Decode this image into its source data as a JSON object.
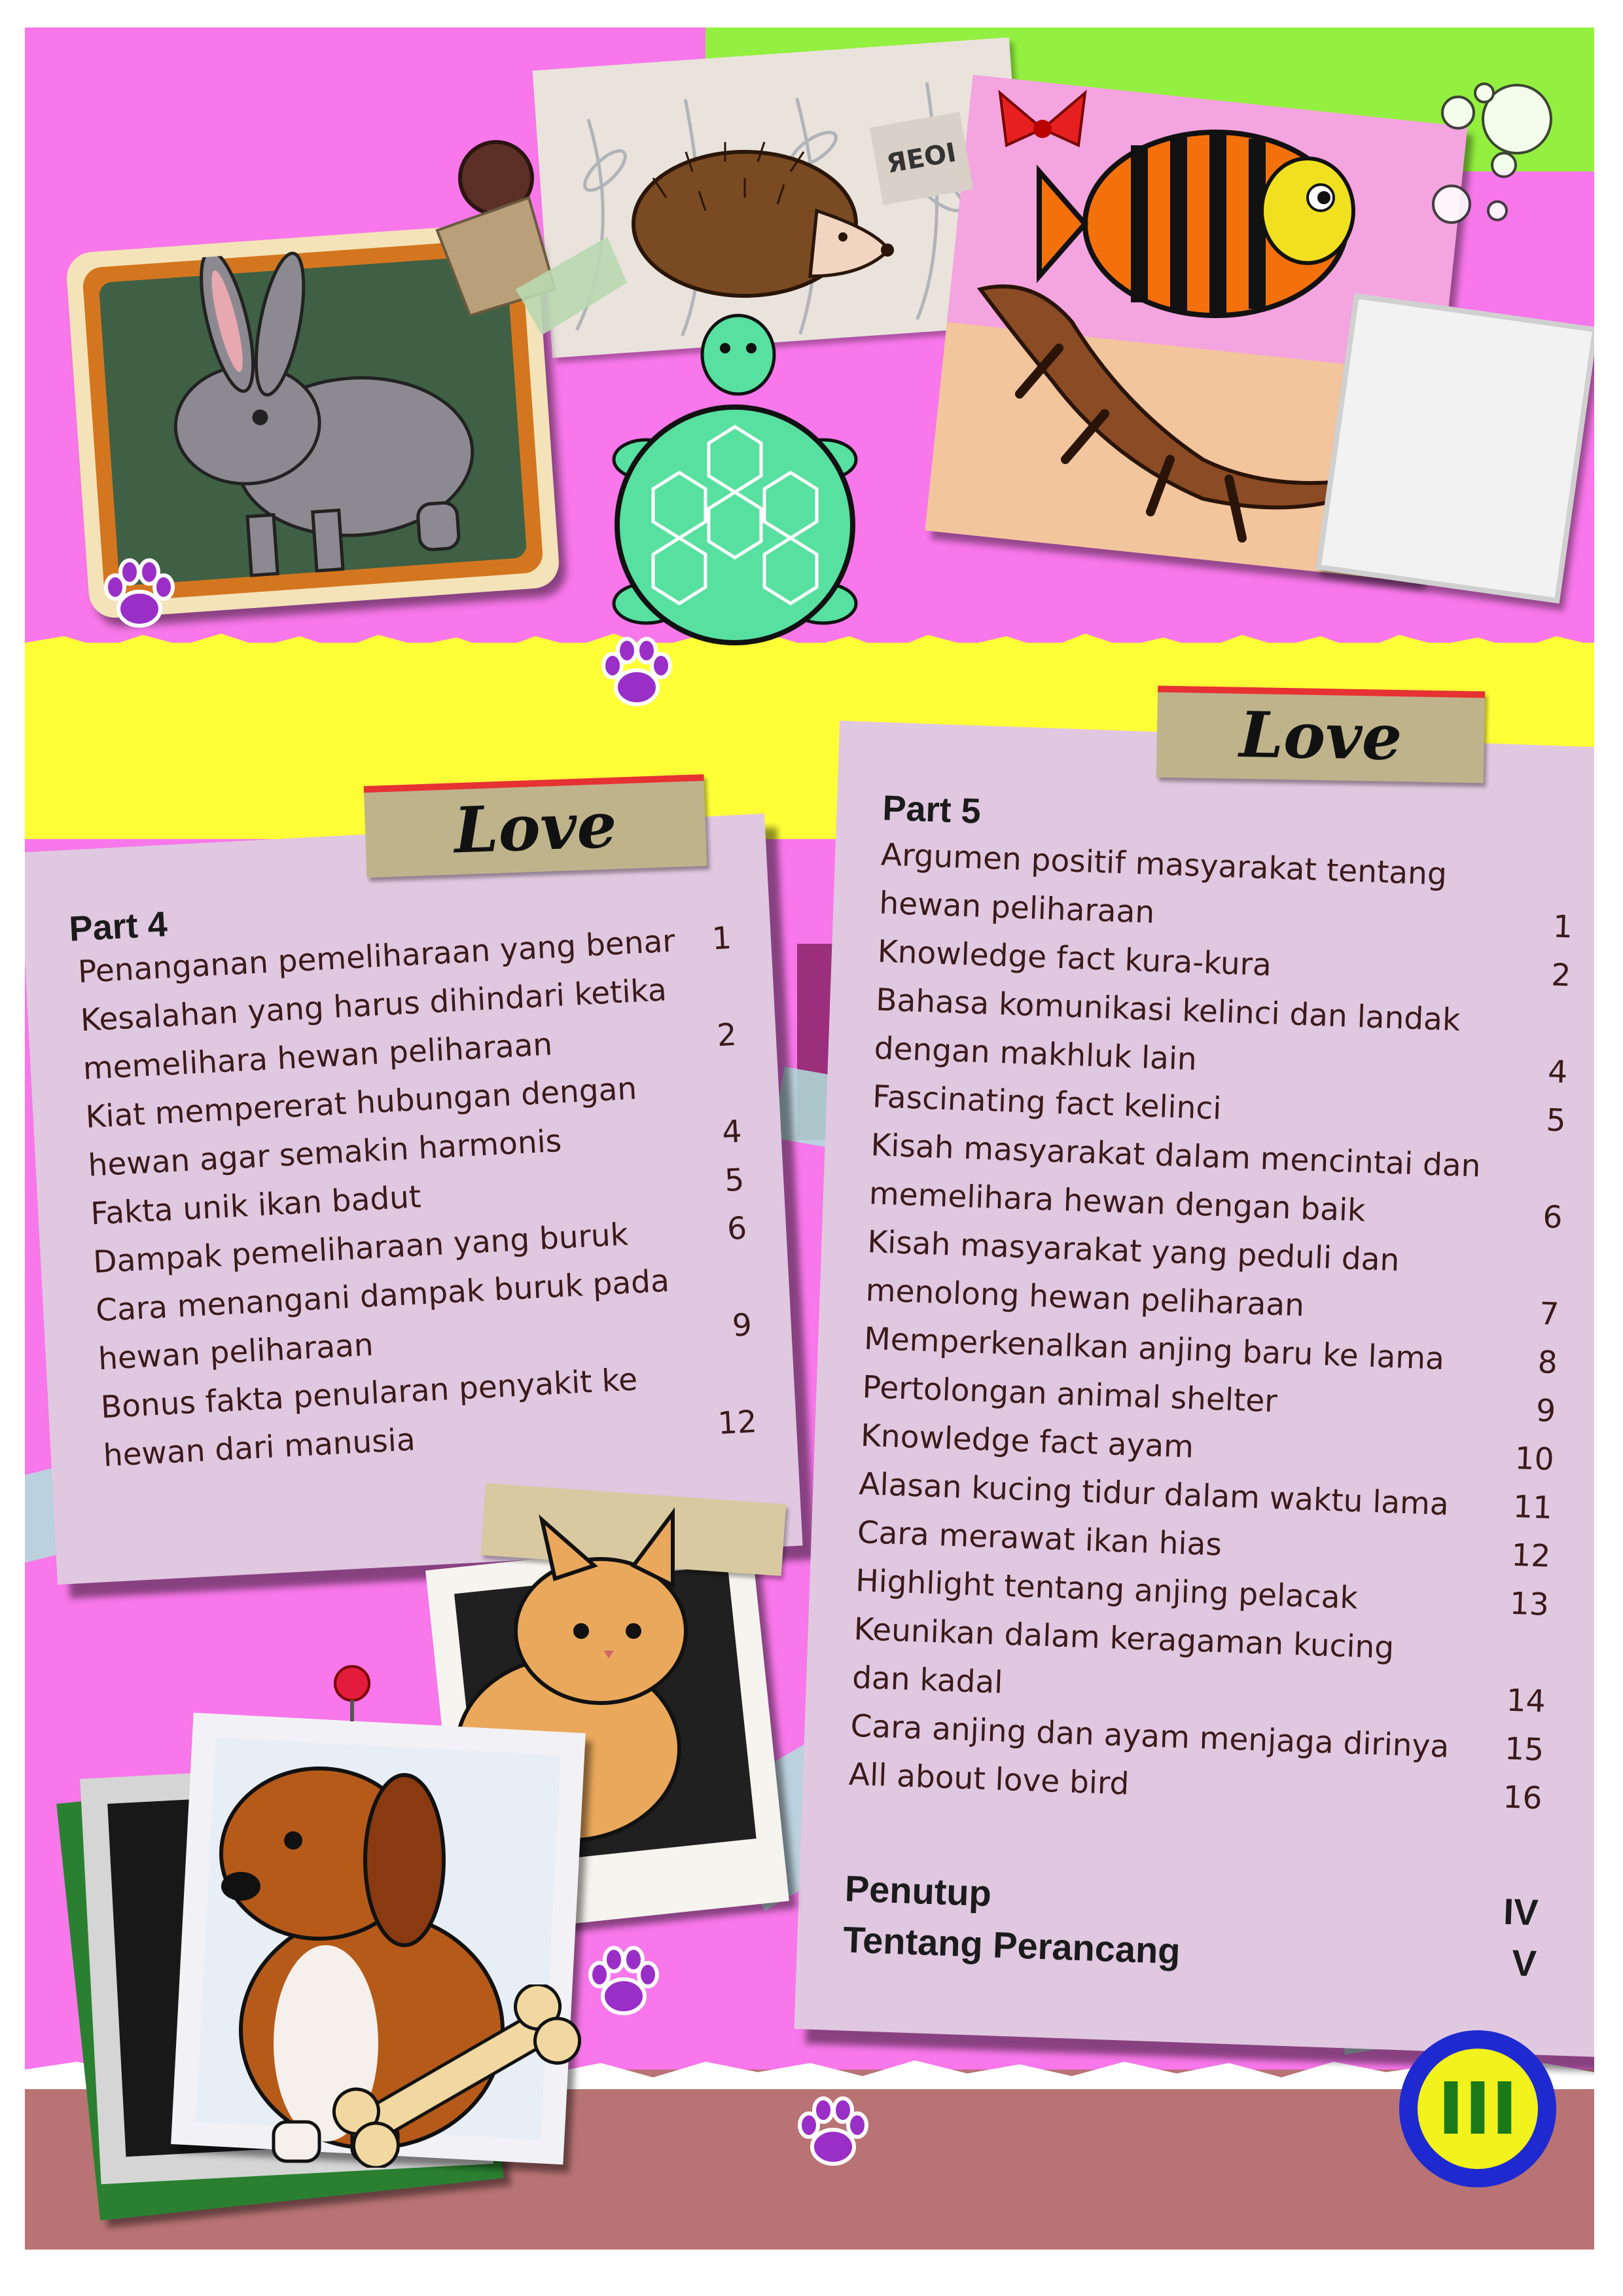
{
  "colors": {
    "page_bg": "#f877ea",
    "yellow_band": "#ffff38",
    "green_band": "#94f040",
    "bottom_band": "#b97374",
    "card": "#e0c8e0",
    "tape": "#b0e0da",
    "paw": "#9a2fc8",
    "page_number_ring": "#1e2ad0",
    "page_number_fill": "#f2f21c"
  },
  "decorations": {
    "tag_text": "Love",
    "fish_label": "ЯEOI"
  },
  "part4": {
    "heading": "Part 4",
    "entries": [
      {
        "lines": [
          "Penanganan pemeliharaan yang benar"
        ],
        "page": "1"
      },
      {
        "lines": [
          "Kesalahan yang harus dihindari ketika",
          "memelihara hewan peliharaan"
        ],
        "page": "2"
      },
      {
        "lines": [
          "Kiat mempererat hubungan dengan",
          "hewan agar semakin harmonis"
        ],
        "page": "4"
      },
      {
        "lines": [
          "Fakta unik ikan badut"
        ],
        "page": "5"
      },
      {
        "lines": [
          "Dampak pemeliharaan yang buruk"
        ],
        "page": "6"
      },
      {
        "lines": [
          "Cara menangani dampak buruk pada",
          "hewan peliharaan"
        ],
        "page": "9"
      },
      {
        "lines": [
          "Bonus fakta penularan penyakit ke",
          "hewan dari manusia"
        ],
        "page": "12"
      }
    ]
  },
  "part5": {
    "heading": "Part 5",
    "entries": [
      {
        "lines": [
          "Argumen positif masyarakat tentang",
          "hewan peliharaan"
        ],
        "page": "1"
      },
      {
        "lines": [
          "Knowledge fact kura-kura"
        ],
        "page": "2"
      },
      {
        "lines": [
          "Bahasa komunikasi kelinci dan landak",
          "dengan makhluk lain"
        ],
        "page": "4"
      },
      {
        "lines": [
          "Fascinating fact kelinci"
        ],
        "page": "5"
      },
      {
        "lines": [
          "Kisah masyarakat dalam mencintai dan",
          "memelihara hewan dengan baik"
        ],
        "page": "6"
      },
      {
        "lines": [
          "Kisah masyarakat yang peduli dan",
          "menolong hewan peliharaan"
        ],
        "page": "7"
      },
      {
        "lines": [
          "Memperkenalkan anjing baru ke lama"
        ],
        "page": "8"
      },
      {
        "lines": [
          "Pertolongan animal shelter"
        ],
        "page": "9"
      },
      {
        "lines": [
          "Knowledge fact ayam"
        ],
        "page": "10"
      },
      {
        "lines": [
          "Alasan kucing tidur dalam waktu lama"
        ],
        "page": "11"
      },
      {
        "lines": [
          "Cara merawat ikan hias"
        ],
        "page": "12"
      },
      {
        "lines": [
          "Highlight tentang anjing pelacak"
        ],
        "page": "13"
      },
      {
        "lines": [
          "Keunikan dalam keragaman kucing",
          "dan kadal"
        ],
        "page": "14"
      },
      {
        "lines": [
          "Cara anjing dan ayam menjaga dirinya"
        ],
        "page": "15"
      },
      {
        "lines": [
          "All about love bird"
        ],
        "page": "16"
      }
    ]
  },
  "closing": [
    {
      "label": "Penutup",
      "page": "IV"
    },
    {
      "label": "Tentang Perancang",
      "page": "V"
    }
  ],
  "page_number": "III"
}
